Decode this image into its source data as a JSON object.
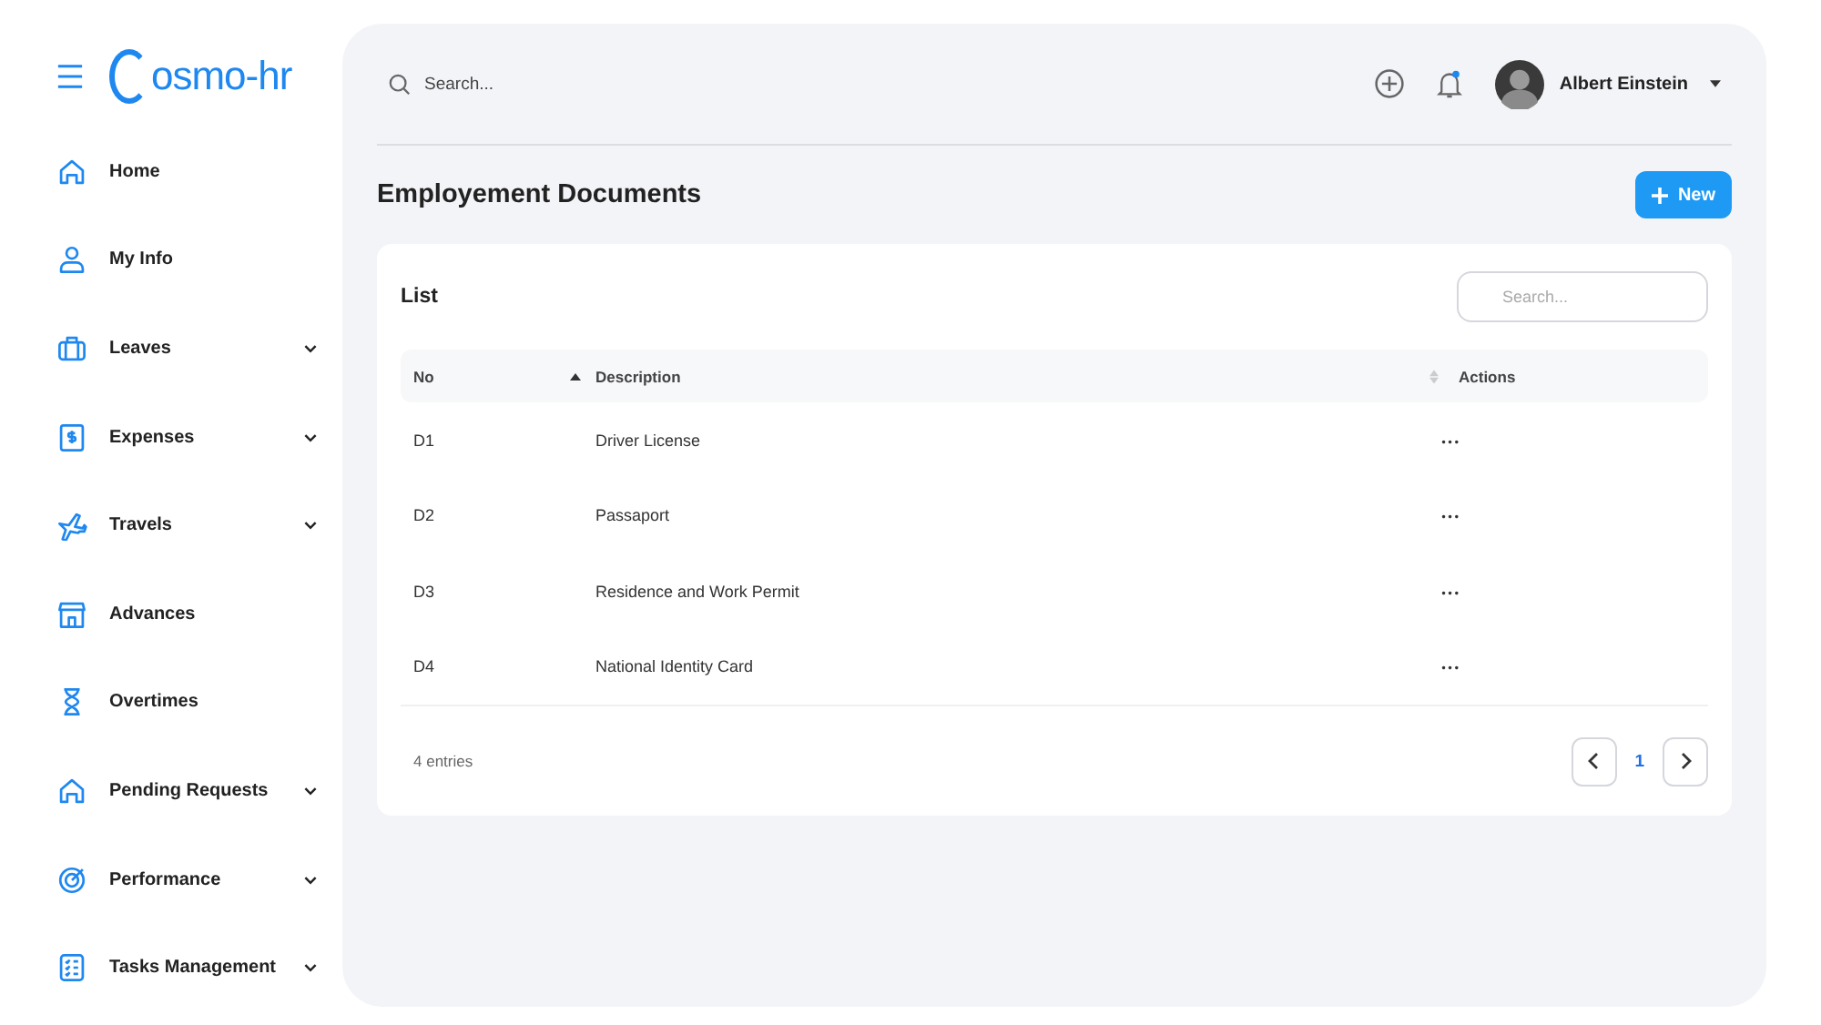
{
  "logo": {
    "text": "osmo-hr"
  },
  "sidebar": {
    "items": [
      {
        "label": "Home",
        "expandable": false
      },
      {
        "label": "My Info",
        "expandable": false
      },
      {
        "label": "Leaves",
        "expandable": true
      },
      {
        "label": "Expenses",
        "expandable": true
      },
      {
        "label": "Travels",
        "expandable": true
      },
      {
        "label": "Advances",
        "expandable": false
      },
      {
        "label": "Overtimes",
        "expandable": false
      },
      {
        "label": "Pending Requests",
        "expandable": true
      },
      {
        "label": "Performance",
        "expandable": true
      },
      {
        "label": "Tasks Management",
        "expandable": true
      }
    ]
  },
  "topbar": {
    "search": {
      "placeholder": "Search..."
    },
    "notification_dot": true,
    "user": {
      "name": "Albert Einstein"
    }
  },
  "page": {
    "title": "Employement Documents",
    "new_button": "New"
  },
  "card": {
    "title": "List",
    "search": {
      "placeholder": "Search..."
    },
    "table": {
      "columns": [
        {
          "label": "No",
          "sortable": true,
          "sorted": true
        },
        {
          "label": "Description",
          "sortable": true,
          "sorted": false
        },
        {
          "label": "Actions",
          "sortable": false
        }
      ],
      "rows": [
        {
          "no": "D1",
          "description": "Driver License",
          "actions": "•••"
        },
        {
          "no": "D2",
          "description": "Passaport",
          "actions": "•••"
        },
        {
          "no": "D3",
          "description": "Residence and Work Permit",
          "actions": "•••"
        },
        {
          "no": "D4",
          "description": "National Identity Card",
          "actions": "•••"
        }
      ]
    },
    "entries": "4 entries",
    "pagination": {
      "pages": [
        {
          "label": "1",
          "selected": true
        }
      ]
    }
  }
}
